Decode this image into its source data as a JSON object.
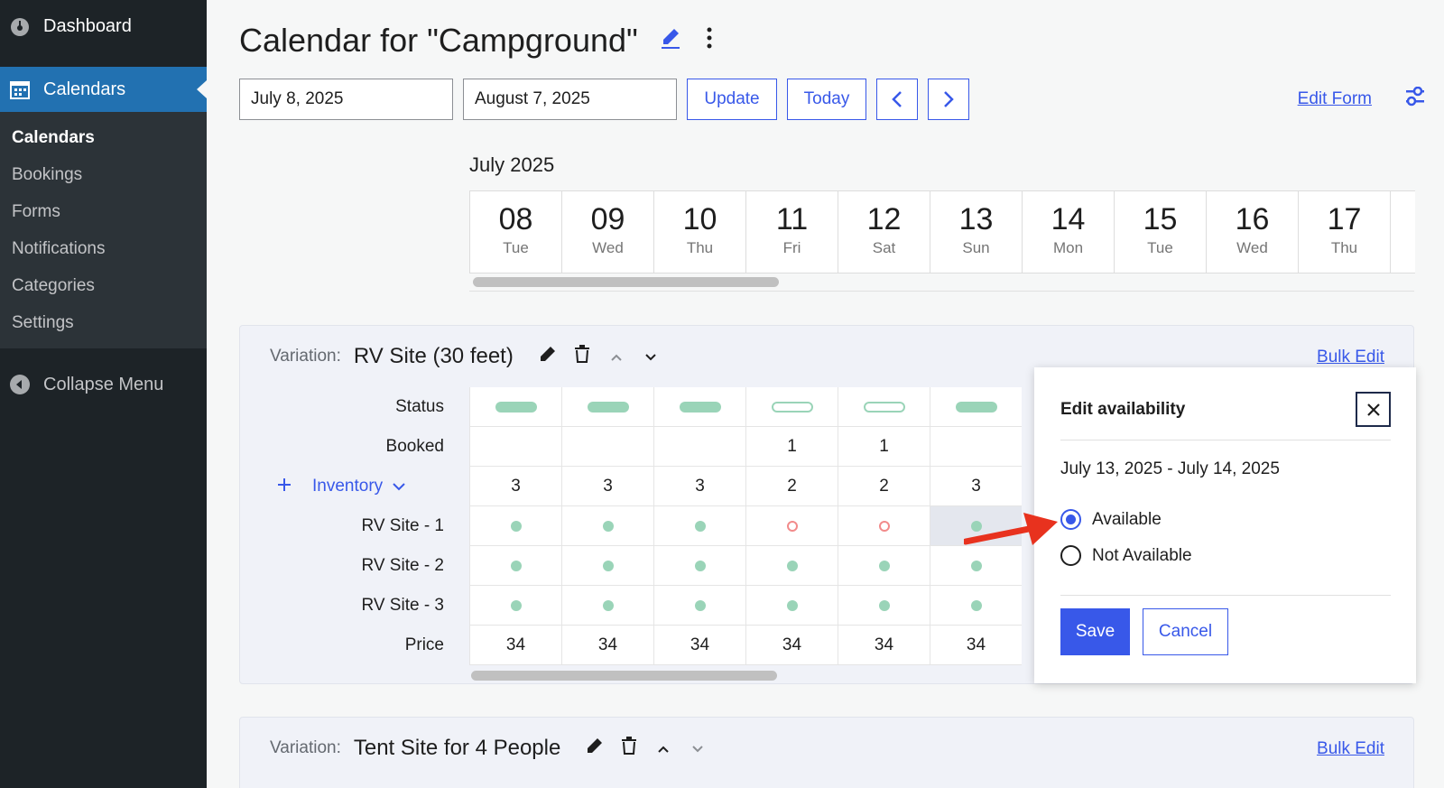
{
  "sidebar": {
    "dashboard_label": "Dashboard",
    "active_label": "Calendars",
    "items": [
      {
        "label": "Calendars",
        "current": true
      },
      {
        "label": "Bookings"
      },
      {
        "label": "Forms"
      },
      {
        "label": "Notifications"
      },
      {
        "label": "Categories"
      },
      {
        "label": "Settings"
      }
    ],
    "collapse_label": "Collapse Menu"
  },
  "header": {
    "title": "Calendar for \"Campground\"",
    "start_date": "July 8, 2025",
    "end_date": "August 7, 2025",
    "update_label": "Update",
    "today_label": "Today",
    "prev_icon": "chevron-left-icon",
    "next_icon": "chevron-right-icon",
    "edit_form_label": "Edit Form"
  },
  "calendar": {
    "month_label": "July 2025",
    "days": [
      {
        "num": "08",
        "wd": "Tue"
      },
      {
        "num": "09",
        "wd": "Wed"
      },
      {
        "num": "10",
        "wd": "Thu"
      },
      {
        "num": "11",
        "wd": "Fri"
      },
      {
        "num": "12",
        "wd": "Sat"
      },
      {
        "num": "13",
        "wd": "Sun"
      },
      {
        "num": "14",
        "wd": "Mon"
      },
      {
        "num": "15",
        "wd": "Tue"
      },
      {
        "num": "16",
        "wd": "Wed"
      },
      {
        "num": "17",
        "wd": "Thu"
      }
    ]
  },
  "variation1": {
    "label": "Variation:",
    "name": "RV Site (30 feet)",
    "bulk_edit_label": "Bulk Edit",
    "row_labels": {
      "status": "Status",
      "booked": "Booked",
      "inventory": "Inventory",
      "site1": "RV Site - 1",
      "site2": "RV Site - 2",
      "site3": "RV Site - 3",
      "price": "Price"
    },
    "booked": [
      "",
      "",
      "",
      "1",
      "1",
      ""
    ],
    "inventory": [
      "3",
      "3",
      "3",
      "2",
      "2",
      "3"
    ],
    "price": [
      "34",
      "34",
      "34",
      "34",
      "34",
      "34"
    ]
  },
  "variation2": {
    "label": "Variation:",
    "name": "Tent Site for 4 People",
    "bulk_edit_label": "Bulk Edit"
  },
  "popup": {
    "title": "Edit availability",
    "date_range": "July 13, 2025 - July 14, 2025",
    "option_available": "Available",
    "option_not_available": "Not Available",
    "save_label": "Save",
    "cancel_label": "Cancel"
  },
  "colors": {
    "accent": "#3858e9",
    "sidebar_bg": "#1d2327",
    "sidebar_active": "#2271b1",
    "available_green": "#9ad4b8",
    "booked_red": "#f28b8b",
    "arrow_red": "#e8321e"
  }
}
